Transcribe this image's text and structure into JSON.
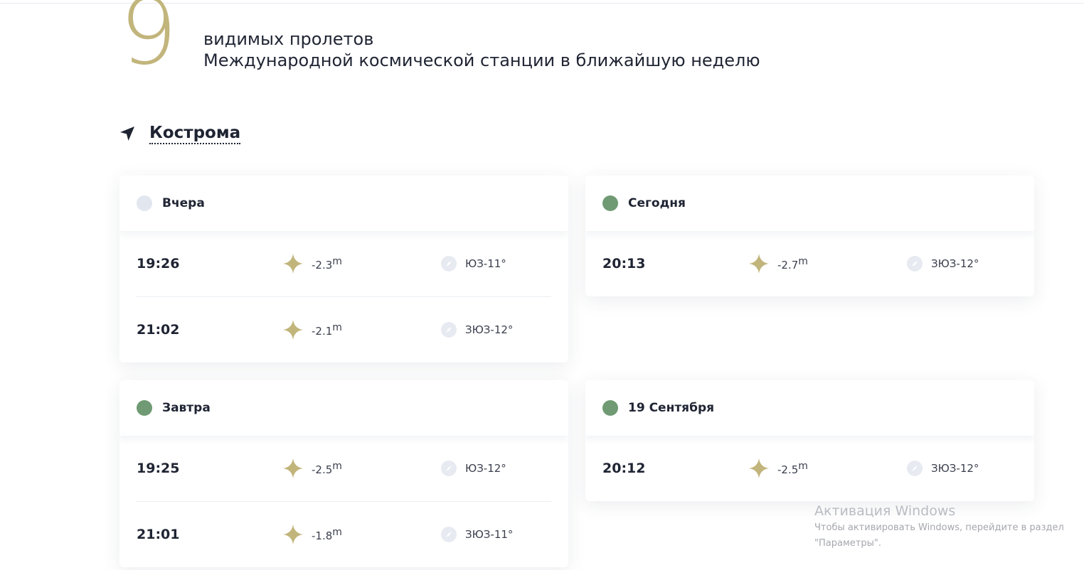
{
  "hero": {
    "count": "9",
    "line1": "видимых пролетов",
    "line2": "Международной космической станции в ближайшую неделю"
  },
  "location": {
    "city": "Кострома",
    "icon": "location-arrow-icon"
  },
  "colors": {
    "accent_gold": "#c2b57c",
    "dot_active": "#6f9a73",
    "dot_past": "#e1e6ef",
    "text_dark": "#1f2433"
  },
  "days": [
    {
      "title": "Вчера",
      "status": "past",
      "passes": [
        {
          "time": "19:26",
          "mag": "-2.3",
          "mag_unit": "m",
          "dir": "ЮЗ-11°"
        },
        {
          "time": "21:02",
          "mag": "-2.1",
          "mag_unit": "m",
          "dir": "ЗЮЗ-12°"
        }
      ]
    },
    {
      "title": "Сегодня",
      "status": "active",
      "passes": [
        {
          "time": "20:13",
          "mag": "-2.7",
          "mag_unit": "m",
          "dir": "ЗЮЗ-12°"
        }
      ]
    },
    {
      "title": "Завтра",
      "status": "active",
      "passes": [
        {
          "time": "19:25",
          "mag": "-2.5",
          "mag_unit": "m",
          "dir": "ЮЗ-12°"
        },
        {
          "time": "21:01",
          "mag": "-1.8",
          "mag_unit": "m",
          "dir": "ЗЮЗ-11°"
        }
      ]
    },
    {
      "title": "19 Сентября",
      "status": "active",
      "passes": [
        {
          "time": "20:12",
          "mag": "-2.5",
          "mag_unit": "m",
          "dir": "ЗЮЗ-12°"
        }
      ]
    }
  ],
  "watermark": {
    "title": "Активация Windows",
    "line1": "Чтобы активировать Windows, перейдите в раздел",
    "line2": "\"Параметры\"."
  }
}
